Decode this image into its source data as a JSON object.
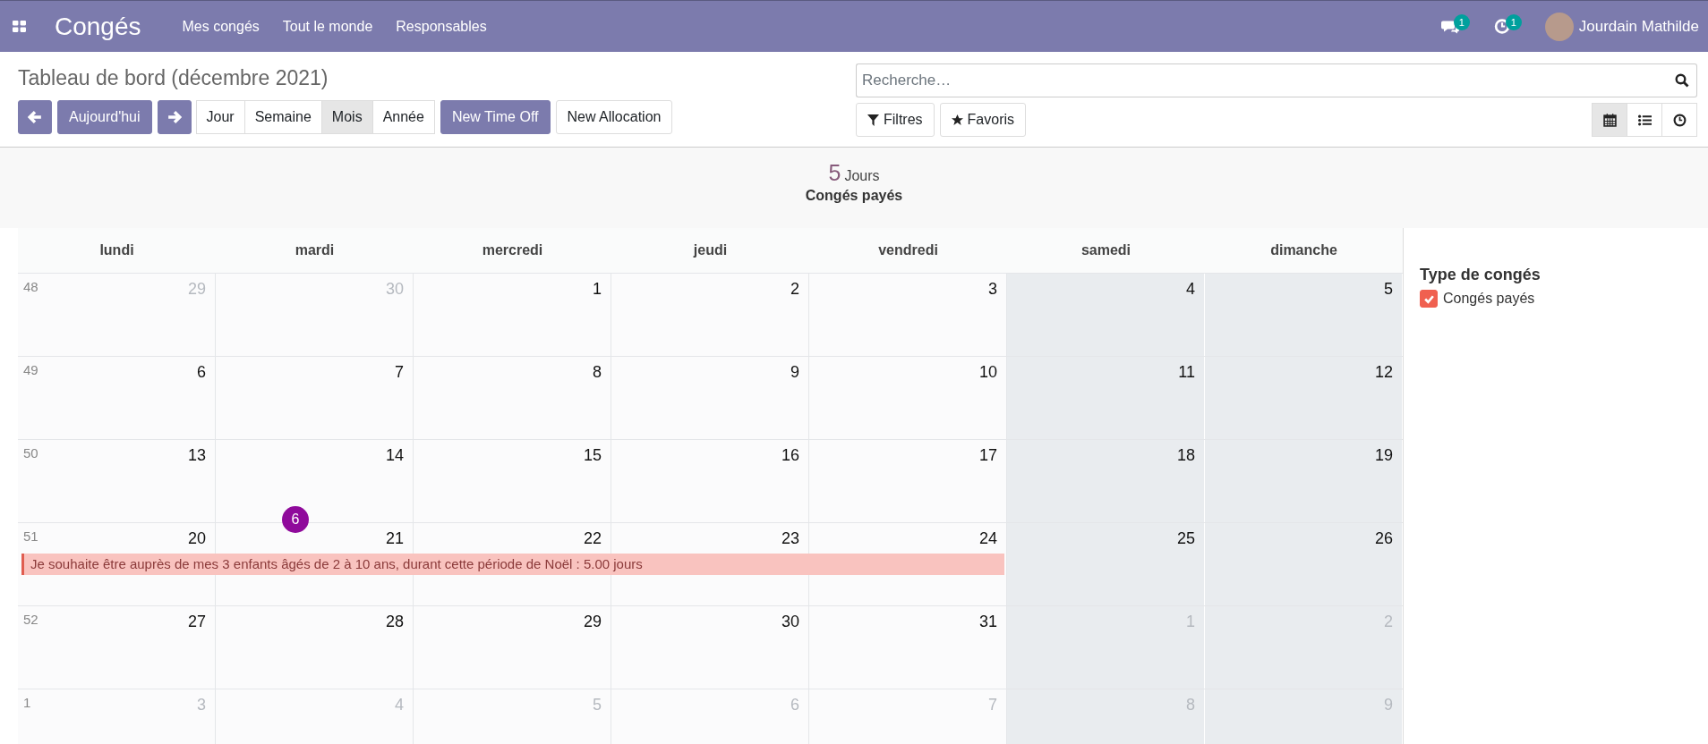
{
  "navbar": {
    "app_title": "Congés",
    "menu": [
      "Mes congés",
      "Tout le monde",
      "Responsables"
    ],
    "messages_count": "1",
    "activities_count": "1",
    "user_name": "Jourdain Mathilde"
  },
  "control_panel": {
    "title": "Tableau de bord (décembre 2021)",
    "today_button": "Aujourd'hui",
    "scales": [
      {
        "label": "Jour",
        "selected": false
      },
      {
        "label": "Semaine",
        "selected": false
      },
      {
        "label": "Mois",
        "selected": true
      },
      {
        "label": "Année",
        "selected": false
      }
    ],
    "actions": [
      "New Time Off",
      "New Allocation"
    ],
    "search": {
      "placeholder": "Recherche…"
    },
    "filters": "Filtres",
    "favorites": "Favoris",
    "views": [
      {
        "kind": "calendar",
        "selected": true
      },
      {
        "kind": "list",
        "selected": false
      },
      {
        "kind": "activity",
        "selected": false
      }
    ]
  },
  "summary": {
    "count": "5",
    "unit": "Jours",
    "label": "Congés payés"
  },
  "calendar": {
    "weekdays": [
      {
        "label": "lundi",
        "weekend": false
      },
      {
        "label": "mardi",
        "weekend": false
      },
      {
        "label": "mercredi",
        "weekend": false
      },
      {
        "label": "jeudi",
        "weekend": false
      },
      {
        "label": "vendredi",
        "weekend": false
      },
      {
        "label": "samedi",
        "weekend": true
      },
      {
        "label": "dimanche",
        "weekend": true
      }
    ],
    "weeks": [
      {
        "number": "48",
        "days": [
          {
            "label": "29",
            "muted": true
          },
          {
            "label": "30",
            "muted": true
          },
          {
            "label": "1",
            "muted": false
          },
          {
            "label": "2",
            "muted": false
          },
          {
            "label": "3",
            "muted": false
          },
          {
            "label": "4",
            "muted": false
          },
          {
            "label": "5",
            "muted": false
          }
        ]
      },
      {
        "number": "49",
        "days": [
          {
            "label": "6",
            "muted": false
          },
          {
            "label": "7",
            "muted": false
          },
          {
            "label": "8",
            "muted": false
          },
          {
            "label": "9",
            "muted": false
          },
          {
            "label": "10",
            "muted": false
          },
          {
            "label": "11",
            "muted": false
          },
          {
            "label": "12",
            "muted": false
          }
        ]
      },
      {
        "number": "50",
        "days": [
          {
            "label": "13",
            "muted": false
          },
          {
            "label": "14",
            "muted": false
          },
          {
            "label": "15",
            "muted": false
          },
          {
            "label": "16",
            "muted": false
          },
          {
            "label": "17",
            "muted": false
          },
          {
            "label": "18",
            "muted": false
          },
          {
            "label": "19",
            "muted": false
          }
        ]
      },
      {
        "number": "51",
        "days": [
          {
            "label": "20",
            "muted": false,
            "in_event": true
          },
          {
            "label": "21",
            "muted": false,
            "in_event": true,
            "badge": "6"
          },
          {
            "label": "22",
            "muted": false,
            "in_event": true
          },
          {
            "label": "23",
            "muted": false,
            "in_event": true
          },
          {
            "label": "24",
            "muted": false,
            "in_event": true
          },
          {
            "label": "25",
            "muted": false
          },
          {
            "label": "26",
            "muted": false
          }
        ],
        "event": {
          "text": "Je souhaite être auprès de mes 3 enfants âgés de 2 à 10 ans, durant cette période de Noël : 5.00 jours",
          "color": "#f9c3bf"
        }
      },
      {
        "number": "52",
        "days": [
          {
            "label": "27",
            "muted": false
          },
          {
            "label": "28",
            "muted": false
          },
          {
            "label": "29",
            "muted": false
          },
          {
            "label": "30",
            "muted": false
          },
          {
            "label": "31",
            "muted": false
          },
          {
            "label": "1",
            "muted": true
          },
          {
            "label": "2",
            "muted": true
          }
        ]
      },
      {
        "number": "1",
        "days": [
          {
            "label": "3",
            "muted": true
          },
          {
            "label": "4",
            "muted": true
          },
          {
            "label": "5",
            "muted": true
          },
          {
            "label": "6",
            "muted": true
          },
          {
            "label": "7",
            "muted": true
          },
          {
            "label": "8",
            "muted": true
          },
          {
            "label": "9",
            "muted": true
          }
        ]
      }
    ]
  },
  "sidebar": {
    "title": "Type de congés",
    "filters": [
      {
        "label": "Congés payés",
        "checked": true,
        "color": "#f06050"
      }
    ]
  }
}
